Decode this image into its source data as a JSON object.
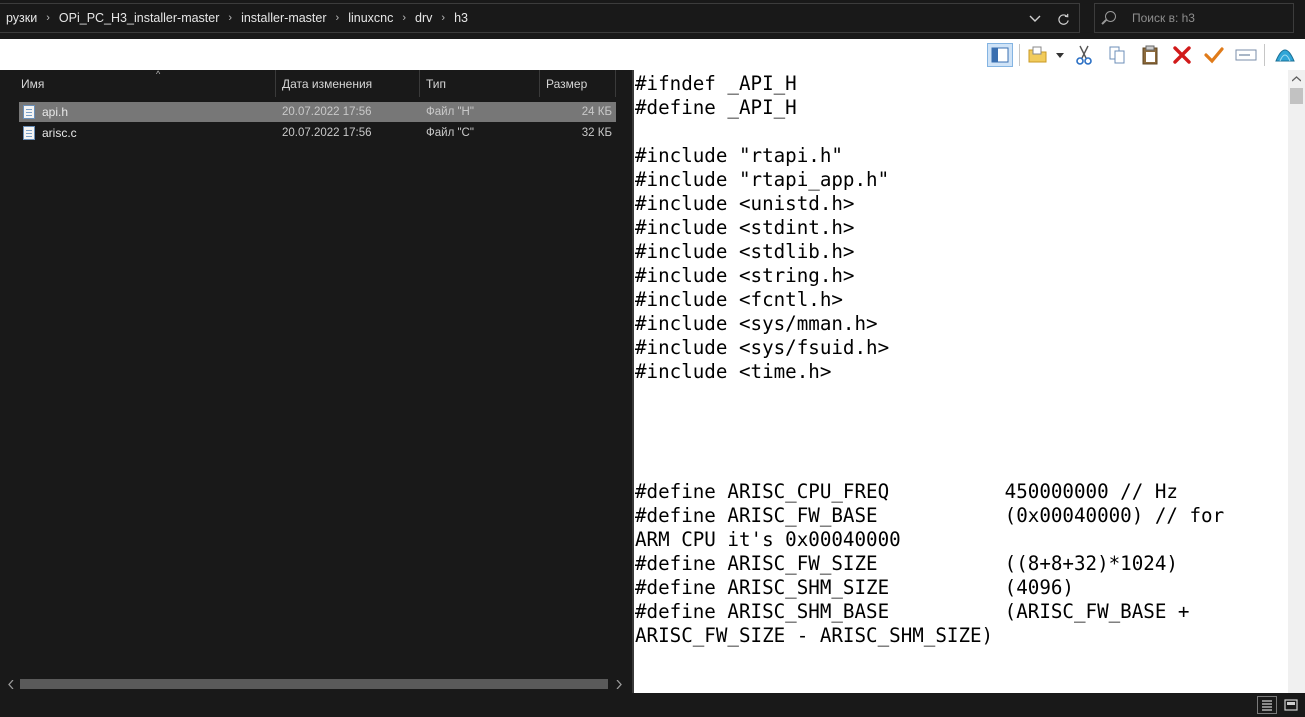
{
  "breadcrumb": [
    "рузки",
    "OPi_PC_H3_installer-master",
    "installer-master",
    "linuxcnc",
    "drv",
    "h3"
  ],
  "search": {
    "placeholder": "Поиск в: h3",
    "value": ""
  },
  "columns": {
    "name": "Имя",
    "date": "Дата изменения",
    "type": "Тип",
    "size": "Размер"
  },
  "files": [
    {
      "name": "api.h",
      "date": "20.07.2022 17:56",
      "type": "Файл \"H\"",
      "size": "24 КБ",
      "selected": true
    },
    {
      "name": "arisc.c",
      "date": "20.07.2022 17:56",
      "type": "Файл \"C\"",
      "size": "32 КБ",
      "selected": false
    }
  ],
  "toolbar": {
    "icons": [
      "preview-pane-icon",
      "new-folder-icon",
      "dropdown-arrow-icon",
      "cut-icon",
      "copy-icon",
      "paste-icon",
      "delete-icon",
      "checkmark-icon",
      "rename-icon",
      "shell-icon"
    ],
    "colors": {
      "delete": "#d11a1a",
      "check": "#e07b1a",
      "cut": "#2a6fc4",
      "active_bg": "#cfe3f7"
    }
  },
  "preview": {
    "code": "#ifndef _API_H\n#define _API_H\n\n#include \"rtapi.h\"\n#include \"rtapi_app.h\"\n#include <unistd.h>\n#include <stdint.h>\n#include <stdlib.h>\n#include <string.h>\n#include <fcntl.h>\n#include <sys/mman.h>\n#include <sys/fsuid.h>\n#include <time.h>\n\n\n\n\n#define ARISC_CPU_FREQ          450000000 // Hz\n#define ARISC_FW_BASE           (0x00040000) // for\nARM CPU it's 0x00040000\n#define ARISC_FW_SIZE           ((8+8+32)*1024)\n#define ARISC_SHM_SIZE          (4096)\n#define ARISC_SHM_BASE          (ARISC_FW_BASE +\nARISC_FW_SIZE - ARISC_SHM_SIZE)"
  },
  "status": {
    "view_modes": [
      "details-view-icon",
      "large-icons-view-icon"
    ]
  }
}
